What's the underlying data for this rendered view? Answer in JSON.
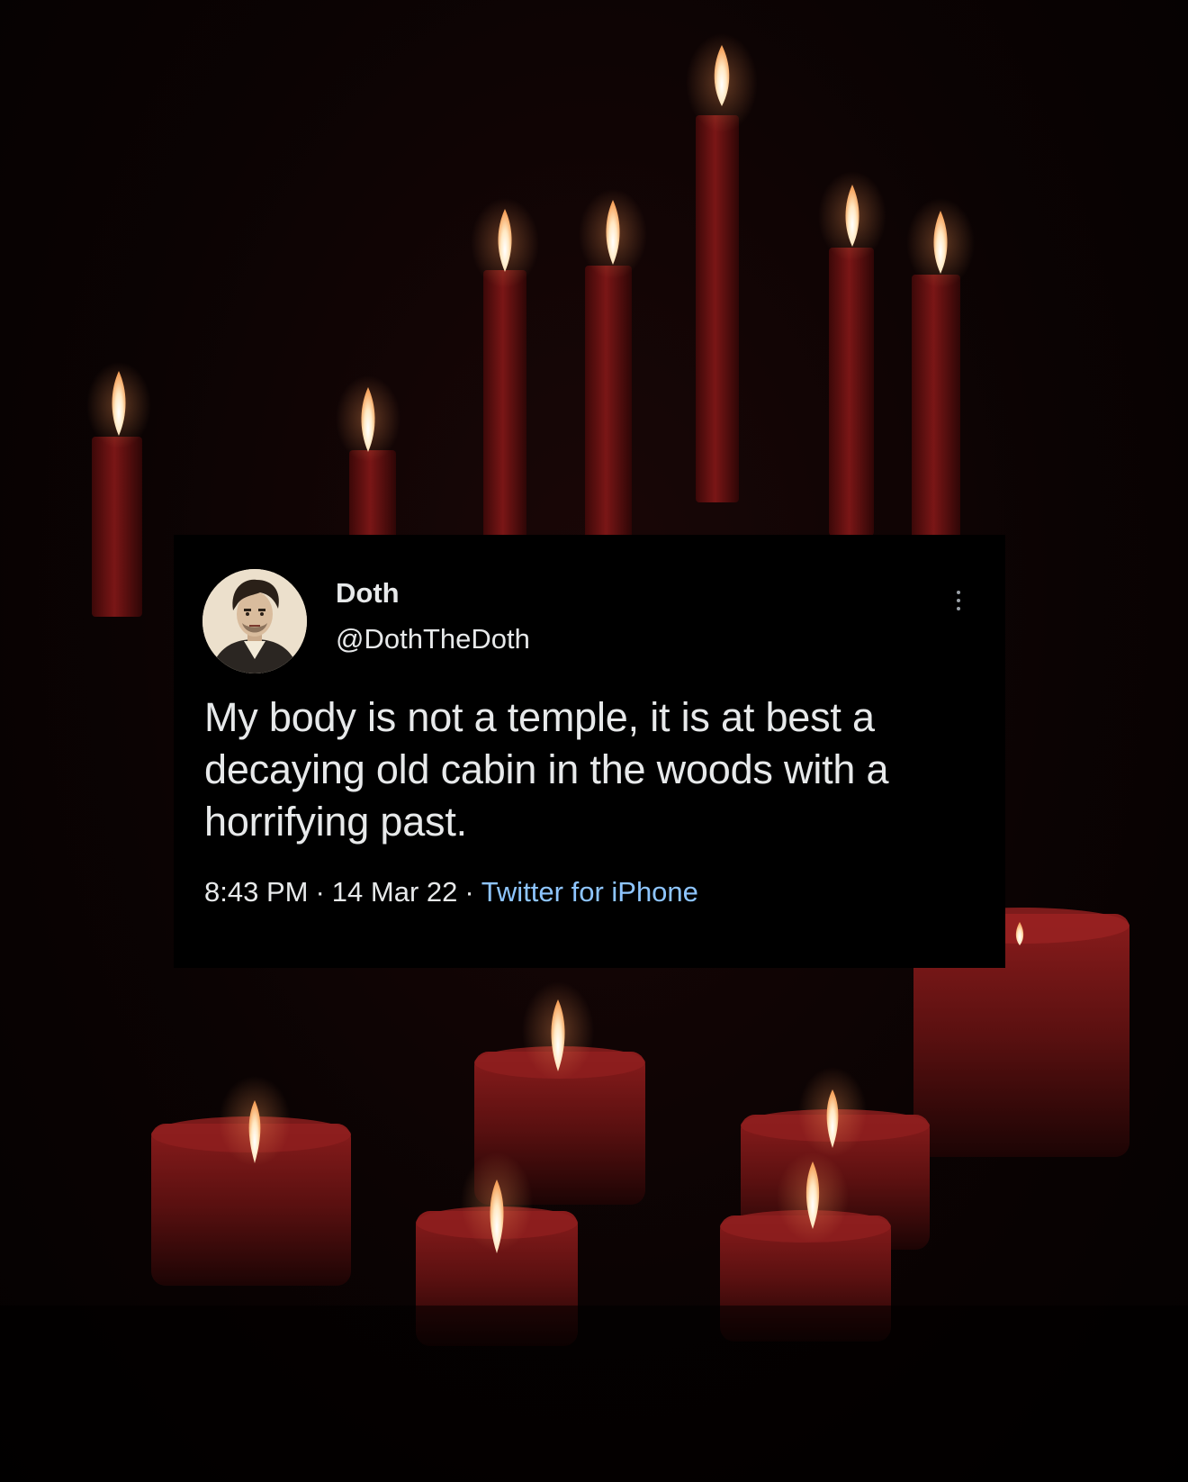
{
  "tweet": {
    "display_name": "Doth",
    "handle": "@DothTheDoth",
    "text": "My body is not a temple, it is at best a decaying old cabin in the woods with a horrifying past.",
    "time": "8:43 PM",
    "date": "14 Mar 22",
    "separator": "·",
    "source": "Twitter for iPhone",
    "more_icon": "more-options-icon",
    "avatar": "portrait-avatar"
  },
  "colors": {
    "card_background": "#000000",
    "text": "#e7e9ea",
    "link": "#8ec5ff",
    "candle_wax": "#6e1414",
    "flame": "#fff4e0"
  }
}
